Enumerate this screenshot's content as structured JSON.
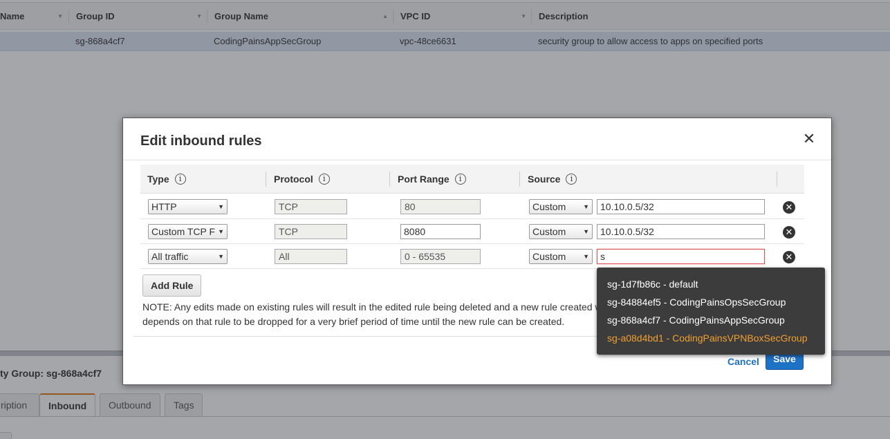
{
  "background": {
    "columns": [
      {
        "label": "Name",
        "sort": "▼"
      },
      {
        "label": "Group ID",
        "sort": "▼"
      },
      {
        "label": "Group Name",
        "sort": "▲"
      },
      {
        "label": "VPC ID",
        "sort": "▼"
      },
      {
        "label": "Description",
        "sort": ""
      }
    ],
    "row": {
      "group_id": "sg-868a4cf7",
      "group_name": "CodingPainsAppSecGroup",
      "vpc_id": "vpc-48ce6631",
      "description": "security group to allow access to apps on specified ports"
    },
    "detail_title": "ty Group: sg-868a4cf7",
    "tabs": [
      {
        "label": "ription",
        "active": false
      },
      {
        "label": "Inbound",
        "active": true
      },
      {
        "label": "Outbound",
        "active": false
      },
      {
        "label": "Tags",
        "active": false
      }
    ]
  },
  "modal": {
    "title": "Edit inbound rules",
    "close_glyph": "✕",
    "headers": {
      "type": "Type",
      "protocol": "Protocol",
      "port_range": "Port Range",
      "source": "Source",
      "info_glyph": "i"
    },
    "rules": [
      {
        "type": "HTTP",
        "protocol": "TCP",
        "port_range": "80",
        "port_editable": false,
        "source_type": "Custom",
        "source_value": "10.10.0.5/32",
        "error": false
      },
      {
        "type": "Custom TCP F",
        "protocol": "TCP",
        "port_range": "8080",
        "port_editable": true,
        "source_type": "Custom",
        "source_value": "10.10.0.5/32",
        "error": false
      },
      {
        "type": "All traffic",
        "protocol": "All",
        "port_range": "0 - 65535",
        "port_editable": false,
        "source_type": "Custom",
        "source_value": "s",
        "error": true
      }
    ],
    "select_arrow": "▼",
    "delete_glyph": "✕",
    "add_rule_label": "Add Rule",
    "note_line1": "NOTE: Any edits made on existing rules will result in the edited rule being deleted and a new rule created w",
    "note_line2": "depends on that rule to be dropped for a very brief period of time until the new rule can be created.",
    "cancel_label": "Cancel",
    "save_label": "Save"
  },
  "autocomplete": {
    "items": [
      {
        "label": "sg-1d7fb86c - default",
        "highlighted": false
      },
      {
        "label": "sg-84884ef5 - CodingPainsOpsSecGroup",
        "highlighted": false
      },
      {
        "label": "sg-868a4cf7 - CodingPainsAppSecGroup",
        "highlighted": false
      },
      {
        "label": "sg-a08d4bd1 - CodingPainsVPNBoxSecGroup",
        "highlighted": true
      }
    ],
    "highlight_color": "#f0a030"
  },
  "colors": {
    "primary_button": "#1e72c6",
    "link": "#1e72c6",
    "active_tab_accent": "#e47911",
    "error_border": "#d9534f"
  }
}
